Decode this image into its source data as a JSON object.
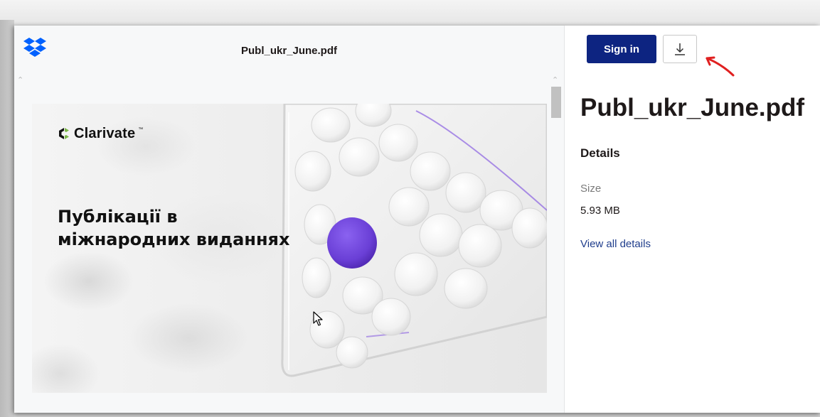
{
  "file_name": "Publ_ukr_June.pdf",
  "pdf_page": {
    "brand": "Clarivate",
    "brand_tm": "™",
    "headline_line1": "Публікації в",
    "headline_line2": "міжнародних виданнях"
  },
  "side_panel": {
    "sign_in_label": "Sign in",
    "download_icon": "download-icon",
    "title": "Publ_ukr_June.pdf",
    "details_heading": "Details",
    "size_label": "Size",
    "size_value": "5.93 MB",
    "view_all_details": "View all details"
  },
  "colors": {
    "primary_button": "#0d2481",
    "link": "#1f3d8c",
    "dropbox_blue": "#0061fe",
    "accent_purple": "#6a3fd6",
    "annotation_red": "#e02020"
  },
  "icons": {
    "logo": "dropbox-logo-icon",
    "scroll_up": "chevron-up-icon",
    "cursor": "mouse-pointer-icon",
    "annotation": "red-arrow-annotation"
  }
}
